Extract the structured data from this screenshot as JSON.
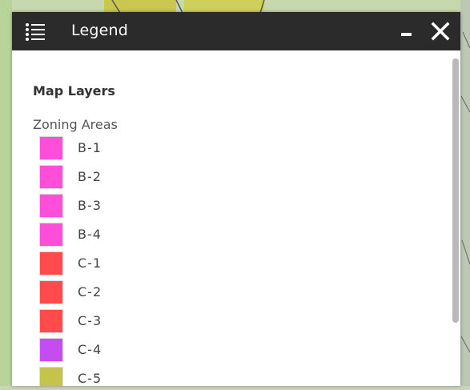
{
  "panel": {
    "title": "Legend",
    "icons": {
      "menu": "list-icon",
      "minimize": "minimize-icon",
      "close": "close-icon"
    }
  },
  "legend": {
    "section_title": "Map Layers",
    "group_title": "Zoning Areas",
    "items": [
      {
        "label": "B-1",
        "color": "#ff4fd8"
      },
      {
        "label": "B-2",
        "color": "#ff4fd8"
      },
      {
        "label": "B-3",
        "color": "#ff4fd8"
      },
      {
        "label": "B-4",
        "color": "#ff4fd8"
      },
      {
        "label": "C-1",
        "color": "#ff4b4b"
      },
      {
        "label": "C-2",
        "color": "#ff4b4b"
      },
      {
        "label": "C-3",
        "color": "#ff4b4b"
      },
      {
        "label": "C-4",
        "color": "#c44cf0"
      },
      {
        "label": "C-5",
        "color": "#c4c44c"
      }
    ]
  },
  "colors": {
    "titlebar_bg": "#2b2b2b",
    "panel_bg": "#ffffff",
    "map_bg": "#c9d8b0"
  }
}
